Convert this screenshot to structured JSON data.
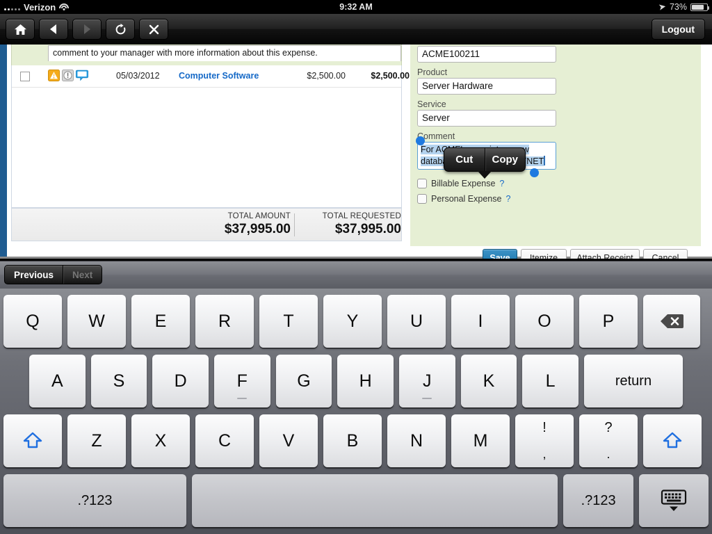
{
  "statusbar": {
    "carrier": "Verizon",
    "time": "9:32 AM",
    "battery_pct": "73%",
    "wifi_icon": "wifi-icon",
    "location_icon": "location-arrow-icon",
    "battery_icon": "battery-icon",
    "signal_icon": "signal-dots-icon"
  },
  "chrome": {
    "home_icon": "home-icon",
    "back_icon": "back-arrow-icon",
    "forward_icon": "forward-arrow-icon",
    "reload_icon": "reload-icon",
    "stop_icon": "close-x-icon",
    "logout_label": "Logout"
  },
  "page": {
    "comment_hint": "comment to your manager with more information about this expense.",
    "row": {
      "date": "05/03/2012",
      "category": "Computer Software",
      "amount": "$2,500.00",
      "requested": "$2,500.00",
      "icons": [
        "warning-triangle-icon",
        "exception-info-icon",
        "comment-bubble-icon"
      ]
    },
    "totals": {
      "amount_label": "TOTAL AMOUNT",
      "amount_value": "$37,995.00",
      "requested_label": "TOTAL REQUESTED",
      "requested_value": "$37,995.00"
    }
  },
  "form": {
    "account_value": "ACME100211",
    "product_label": "Product",
    "product_value": "Server Hardware",
    "service_label": "Service",
    "service_value": "Server",
    "comment_label": "Comment",
    "comment_line1": "For ACME's proprietary new",
    "comment_line2": "database, codenamed SKYNET",
    "billable_label": "Billable Expense",
    "billable_help": "?",
    "personal_label": "Personal Expense",
    "personal_help": "?",
    "buttons": {
      "save": "Save",
      "itemize": "Itemize",
      "attach": "Attach Receipt",
      "cancel": "Cancel"
    }
  },
  "callout": {
    "cut": "Cut",
    "copy": "Copy"
  },
  "accessory": {
    "previous": "Previous",
    "next": "Next"
  },
  "keyboard": {
    "row1": [
      "Q",
      "W",
      "E",
      "R",
      "T",
      "Y",
      "U",
      "I",
      "O",
      "P"
    ],
    "row2": [
      "A",
      "S",
      "D",
      "F",
      "G",
      "H",
      "J",
      "K",
      "L"
    ],
    "row3": [
      "Z",
      "X",
      "C",
      "V",
      "B",
      "N",
      "M"
    ],
    "punct": [
      {
        "top": "!",
        "bottom": ","
      },
      {
        "top": "?",
        "bottom": "."
      }
    ],
    "return_label": "return",
    "numeric_left": ".?123",
    "numeric_right": ".?123",
    "backspace_icon": "backspace-icon",
    "shift_icon": "shift-arrow-icon",
    "hide_keyboard_icon": "hide-keyboard-icon",
    "space_label": ""
  },
  "colors": {
    "accent_blue": "#1572a8",
    "link_blue": "#1569c7",
    "form_green": "#e6efd4",
    "selection_blue": "#b4d3ef",
    "handle_blue": "#1f7ae0",
    "left_rail": "#1f5c91"
  }
}
